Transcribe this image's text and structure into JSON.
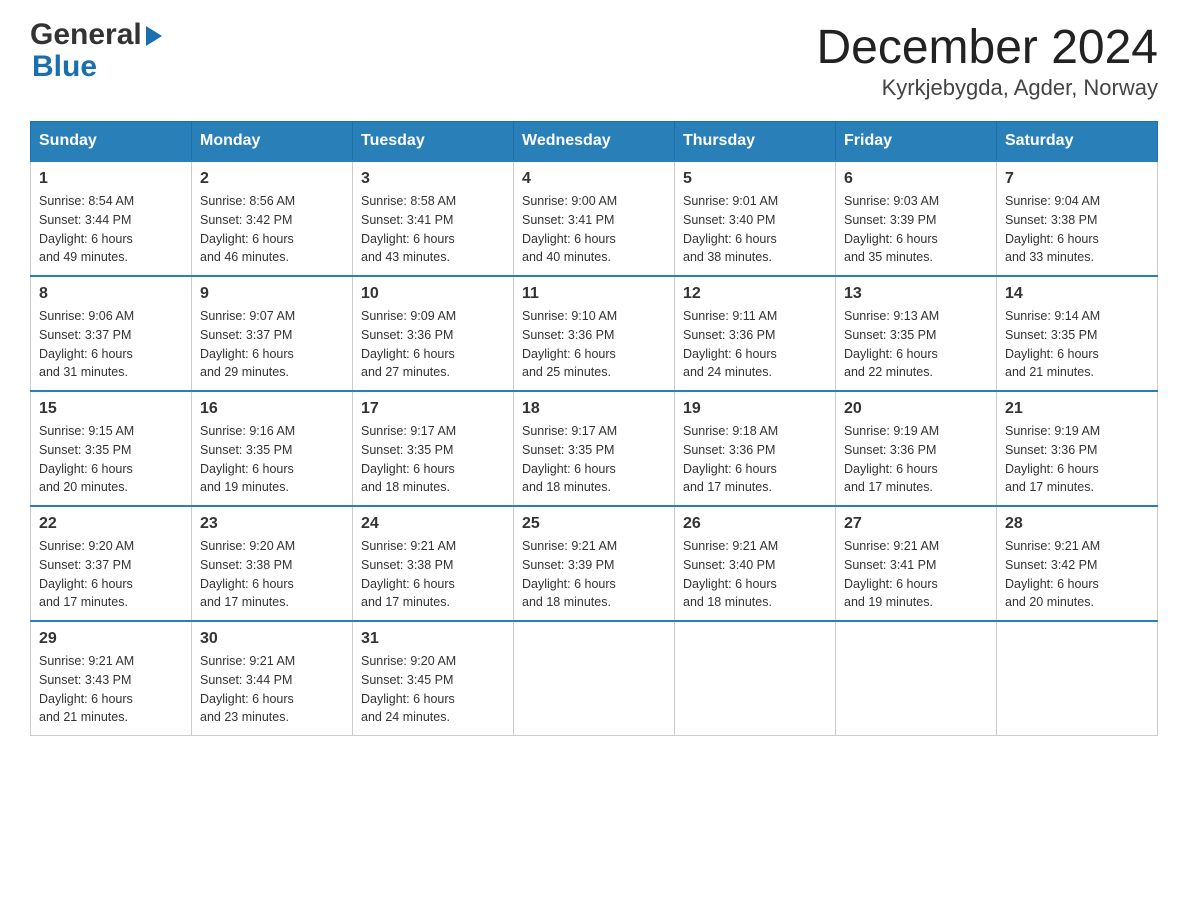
{
  "header": {
    "logo_general": "General",
    "logo_blue": "Blue",
    "title": "December 2024",
    "subtitle": "Kyrkjebygda, Agder, Norway"
  },
  "weekdays": [
    "Sunday",
    "Monday",
    "Tuesday",
    "Wednesday",
    "Thursday",
    "Friday",
    "Saturday"
  ],
  "weeks": [
    [
      {
        "day": "1",
        "sunrise": "8:54 AM",
        "sunset": "3:44 PM",
        "daylight": "6 hours and 49 minutes."
      },
      {
        "day": "2",
        "sunrise": "8:56 AM",
        "sunset": "3:42 PM",
        "daylight": "6 hours and 46 minutes."
      },
      {
        "day": "3",
        "sunrise": "8:58 AM",
        "sunset": "3:41 PM",
        "daylight": "6 hours and 43 minutes."
      },
      {
        "day": "4",
        "sunrise": "9:00 AM",
        "sunset": "3:41 PM",
        "daylight": "6 hours and 40 minutes."
      },
      {
        "day": "5",
        "sunrise": "9:01 AM",
        "sunset": "3:40 PM",
        "daylight": "6 hours and 38 minutes."
      },
      {
        "day": "6",
        "sunrise": "9:03 AM",
        "sunset": "3:39 PM",
        "daylight": "6 hours and 35 minutes."
      },
      {
        "day": "7",
        "sunrise": "9:04 AM",
        "sunset": "3:38 PM",
        "daylight": "6 hours and 33 minutes."
      }
    ],
    [
      {
        "day": "8",
        "sunrise": "9:06 AM",
        "sunset": "3:37 PM",
        "daylight": "6 hours and 31 minutes."
      },
      {
        "day": "9",
        "sunrise": "9:07 AM",
        "sunset": "3:37 PM",
        "daylight": "6 hours and 29 minutes."
      },
      {
        "day": "10",
        "sunrise": "9:09 AM",
        "sunset": "3:36 PM",
        "daylight": "6 hours and 27 minutes."
      },
      {
        "day": "11",
        "sunrise": "9:10 AM",
        "sunset": "3:36 PM",
        "daylight": "6 hours and 25 minutes."
      },
      {
        "day": "12",
        "sunrise": "9:11 AM",
        "sunset": "3:36 PM",
        "daylight": "6 hours and 24 minutes."
      },
      {
        "day": "13",
        "sunrise": "9:13 AM",
        "sunset": "3:35 PM",
        "daylight": "6 hours and 22 minutes."
      },
      {
        "day": "14",
        "sunrise": "9:14 AM",
        "sunset": "3:35 PM",
        "daylight": "6 hours and 21 minutes."
      }
    ],
    [
      {
        "day": "15",
        "sunrise": "9:15 AM",
        "sunset": "3:35 PM",
        "daylight": "6 hours and 20 minutes."
      },
      {
        "day": "16",
        "sunrise": "9:16 AM",
        "sunset": "3:35 PM",
        "daylight": "6 hours and 19 minutes."
      },
      {
        "day": "17",
        "sunrise": "9:17 AM",
        "sunset": "3:35 PM",
        "daylight": "6 hours and 18 minutes."
      },
      {
        "day": "18",
        "sunrise": "9:17 AM",
        "sunset": "3:35 PM",
        "daylight": "6 hours and 18 minutes."
      },
      {
        "day": "19",
        "sunrise": "9:18 AM",
        "sunset": "3:36 PM",
        "daylight": "6 hours and 17 minutes."
      },
      {
        "day": "20",
        "sunrise": "9:19 AM",
        "sunset": "3:36 PM",
        "daylight": "6 hours and 17 minutes."
      },
      {
        "day": "21",
        "sunrise": "9:19 AM",
        "sunset": "3:36 PM",
        "daylight": "6 hours and 17 minutes."
      }
    ],
    [
      {
        "day": "22",
        "sunrise": "9:20 AM",
        "sunset": "3:37 PM",
        "daylight": "6 hours and 17 minutes."
      },
      {
        "day": "23",
        "sunrise": "9:20 AM",
        "sunset": "3:38 PM",
        "daylight": "6 hours and 17 minutes."
      },
      {
        "day": "24",
        "sunrise": "9:21 AM",
        "sunset": "3:38 PM",
        "daylight": "6 hours and 17 minutes."
      },
      {
        "day": "25",
        "sunrise": "9:21 AM",
        "sunset": "3:39 PM",
        "daylight": "6 hours and 18 minutes."
      },
      {
        "day": "26",
        "sunrise": "9:21 AM",
        "sunset": "3:40 PM",
        "daylight": "6 hours and 18 minutes."
      },
      {
        "day": "27",
        "sunrise": "9:21 AM",
        "sunset": "3:41 PM",
        "daylight": "6 hours and 19 minutes."
      },
      {
        "day": "28",
        "sunrise": "9:21 AM",
        "sunset": "3:42 PM",
        "daylight": "6 hours and 20 minutes."
      }
    ],
    [
      {
        "day": "29",
        "sunrise": "9:21 AM",
        "sunset": "3:43 PM",
        "daylight": "6 hours and 21 minutes."
      },
      {
        "day": "30",
        "sunrise": "9:21 AM",
        "sunset": "3:44 PM",
        "daylight": "6 hours and 23 minutes."
      },
      {
        "day": "31",
        "sunrise": "9:20 AM",
        "sunset": "3:45 PM",
        "daylight": "6 hours and 24 minutes."
      },
      null,
      null,
      null,
      null
    ]
  ],
  "labels": {
    "sunrise": "Sunrise:",
    "sunset": "Sunset:",
    "daylight": "Daylight:"
  }
}
